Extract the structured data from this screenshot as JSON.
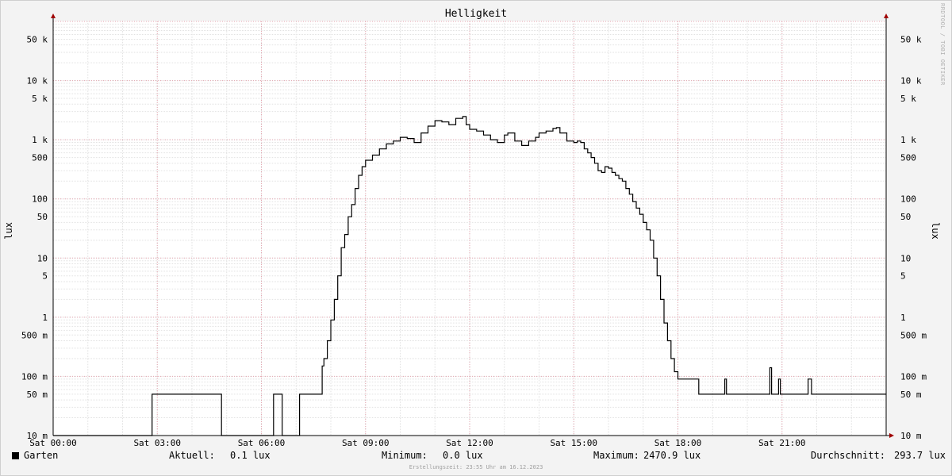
{
  "header": {
    "title": "Helligkeit",
    "watermark": "RRDTOOL / TOBI OETIKER"
  },
  "chart_data": {
    "type": "line",
    "title": "Helligkeit",
    "ylabel": "lux",
    "yscale": "log",
    "ylim": [
      0.01,
      100000
    ],
    "xlim": [
      0,
      24
    ],
    "x_ticks": [
      {
        "h": 0,
        "label": "Sat 00:00"
      },
      {
        "h": 3,
        "label": "Sat 03:00"
      },
      {
        "h": 6,
        "label": "Sat 06:00"
      },
      {
        "h": 9,
        "label": "Sat 09:00"
      },
      {
        "h": 12,
        "label": "Sat 12:00"
      },
      {
        "h": 15,
        "label": "Sat 15:00"
      },
      {
        "h": 18,
        "label": "Sat 18:00"
      },
      {
        "h": 21,
        "label": "Sat 21:00"
      }
    ],
    "y_ticks": [
      {
        "v": 0.01,
        "label": "10 m"
      },
      {
        "v": 0.05,
        "label": "50 m"
      },
      {
        "v": 0.1,
        "label": "100 m"
      },
      {
        "v": 0.5,
        "label": "500 m"
      },
      {
        "v": 1,
        "label": "1"
      },
      {
        "v": 5,
        "label": "5"
      },
      {
        "v": 10,
        "label": "10"
      },
      {
        "v": 50,
        "label": "50"
      },
      {
        "v": 100,
        "label": "100"
      },
      {
        "v": 500,
        "label": "500"
      },
      {
        "v": 1000,
        "label": "1 k"
      },
      {
        "v": 5000,
        "label": "5 k"
      },
      {
        "v": 10000,
        "label": "10 k"
      },
      {
        "v": 50000,
        "label": "50 k"
      }
    ],
    "grid": true,
    "series": [
      {
        "name": "Garten",
        "color": "#000000",
        "points": [
          [
            0,
            0.01
          ],
          [
            2.8,
            0.01
          ],
          [
            2.85,
            0.05
          ],
          [
            4.8,
            0.05
          ],
          [
            4.85,
            0.01
          ],
          [
            6.3,
            0.01
          ],
          [
            6.35,
            0.05
          ],
          [
            6.55,
            0.05
          ],
          [
            6.6,
            0.01
          ],
          [
            7.05,
            0.01
          ],
          [
            7.1,
            0.05
          ],
          [
            7.7,
            0.05
          ],
          [
            7.75,
            0.15
          ],
          [
            7.8,
            0.2
          ],
          [
            7.9,
            0.4
          ],
          [
            8.0,
            0.9
          ],
          [
            8.1,
            2
          ],
          [
            8.2,
            5
          ],
          [
            8.3,
            15
          ],
          [
            8.4,
            25
          ],
          [
            8.5,
            50
          ],
          [
            8.6,
            80
          ],
          [
            8.7,
            150
          ],
          [
            8.8,
            250
          ],
          [
            8.9,
            350
          ],
          [
            9.0,
            450
          ],
          [
            9.2,
            550
          ],
          [
            9.4,
            700
          ],
          [
            9.6,
            850
          ],
          [
            9.8,
            950
          ],
          [
            10.0,
            1100
          ],
          [
            10.2,
            1050
          ],
          [
            10.4,
            900
          ],
          [
            10.6,
            1300
          ],
          [
            10.8,
            1700
          ],
          [
            11.0,
            2100
          ],
          [
            11.2,
            2000
          ],
          [
            11.4,
            1800
          ],
          [
            11.6,
            2300
          ],
          [
            11.8,
            2470
          ],
          [
            11.9,
            1800
          ],
          [
            12.0,
            1500
          ],
          [
            12.2,
            1400
          ],
          [
            12.4,
            1200
          ],
          [
            12.6,
            1000
          ],
          [
            12.8,
            900
          ],
          [
            13.0,
            1200
          ],
          [
            13.1,
            1300
          ],
          [
            13.3,
            950
          ],
          [
            13.5,
            800
          ],
          [
            13.7,
            950
          ],
          [
            13.9,
            1100
          ],
          [
            14.0,
            1300
          ],
          [
            14.2,
            1400
          ],
          [
            14.4,
            1550
          ],
          [
            14.5,
            1600
          ],
          [
            14.6,
            1300
          ],
          [
            14.8,
            950
          ],
          [
            15.0,
            900
          ],
          [
            15.1,
            950
          ],
          [
            15.2,
            900
          ],
          [
            15.3,
            700
          ],
          [
            15.4,
            600
          ],
          [
            15.5,
            500
          ],
          [
            15.6,
            400
          ],
          [
            15.7,
            300
          ],
          [
            15.8,
            280
          ],
          [
            15.9,
            350
          ],
          [
            16.0,
            330
          ],
          [
            16.1,
            280
          ],
          [
            16.2,
            250
          ],
          [
            16.3,
            220
          ],
          [
            16.4,
            200
          ],
          [
            16.5,
            150
          ],
          [
            16.6,
            120
          ],
          [
            16.7,
            90
          ],
          [
            16.8,
            70
          ],
          [
            16.9,
            55
          ],
          [
            17.0,
            40
          ],
          [
            17.1,
            30
          ],
          [
            17.2,
            20
          ],
          [
            17.3,
            10
          ],
          [
            17.4,
            5
          ],
          [
            17.5,
            2
          ],
          [
            17.6,
            0.8
          ],
          [
            17.7,
            0.4
          ],
          [
            17.8,
            0.2
          ],
          [
            17.9,
            0.12
          ],
          [
            18.0,
            0.09
          ],
          [
            18.5,
            0.09
          ],
          [
            18.6,
            0.05
          ],
          [
            19.3,
            0.05
          ],
          [
            19.35,
            0.09
          ],
          [
            19.4,
            0.05
          ],
          [
            20.6,
            0.05
          ],
          [
            20.65,
            0.14
          ],
          [
            20.7,
            0.05
          ],
          [
            20.85,
            0.05
          ],
          [
            20.9,
            0.09
          ],
          [
            20.95,
            0.05
          ],
          [
            21.7,
            0.05
          ],
          [
            21.75,
            0.09
          ],
          [
            21.85,
            0.05
          ],
          [
            24.0,
            0.05
          ]
        ]
      }
    ]
  },
  "legend": {
    "series_name": "Garten",
    "current_label": "Aktuell:",
    "current_value": "0.1 lux",
    "min_label": "Minimum:",
    "min_value": "0.0 lux",
    "max_label": "Maximum:",
    "max_value": "2470.9 lux",
    "avg_label": "Durchschnitt:",
    "avg_value": "293.7 lux"
  },
  "footer": {
    "text": "Erstellungszeit: 23:55 Uhr am 16.12.2023"
  }
}
